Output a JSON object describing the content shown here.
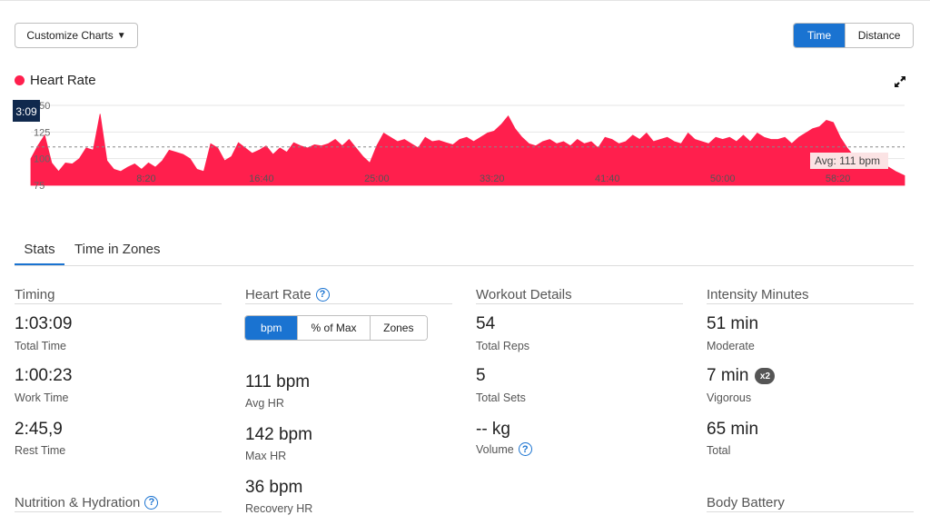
{
  "toolbar": {
    "customize_label": "Customize Charts",
    "customize_icon": "caret-down",
    "axis_toggle": [
      "Time",
      "Distance"
    ],
    "axis_active": "Time"
  },
  "chart": {
    "title": "Heart Rate",
    "series_color": "#ff1f4d",
    "cursor_label": "3:09",
    "avg_label": "Avg: 111 bpm",
    "expand_icon": "expand-arrows-icon"
  },
  "chart_data": {
    "type": "area",
    "title": "Heart Rate",
    "xlabel": "",
    "ylabel": "",
    "ylim": [
      75,
      150
    ],
    "y_ticks": [
      "150",
      "125",
      "100",
      "75"
    ],
    "x_ticks": [
      "8:20",
      "16:40",
      "25:00",
      "33:20",
      "41:40",
      "50:00",
      "58:20"
    ],
    "x_range_seconds": [
      0,
      3789
    ],
    "average": 111,
    "grid": true,
    "series": [
      {
        "color": "#ff1f4d",
        "x_seconds": [
          0,
          30,
          60,
          90,
          120,
          150,
          180,
          210,
          240,
          270,
          300,
          330,
          360,
          390,
          420,
          450,
          480,
          510,
          540,
          570,
          600,
          630,
          660,
          690,
          720,
          750,
          780,
          810,
          840,
          870,
          900,
          930,
          960,
          990,
          1020,
          1050,
          1080,
          1110,
          1140,
          1170,
          1200,
          1230,
          1260,
          1290,
          1320,
          1350,
          1380,
          1410,
          1440,
          1470,
          1500,
          1530,
          1560,
          1590,
          1620,
          1650,
          1680,
          1710,
          1740,
          1770,
          1800,
          1830,
          1860,
          1890,
          1920,
          1950,
          1980,
          2010,
          2040,
          2070,
          2100,
          2130,
          2160,
          2190,
          2220,
          2250,
          2280,
          2310,
          2340,
          2370,
          2400,
          2430,
          2460,
          2490,
          2520,
          2550,
          2580,
          2610,
          2640,
          2670,
          2700,
          2730,
          2760,
          2790,
          2820,
          2850,
          2880,
          2910,
          2940,
          2970,
          3000,
          3030,
          3060,
          3090,
          3120,
          3150,
          3180,
          3210,
          3240,
          3270,
          3300,
          3330,
          3360,
          3390,
          3420,
          3450,
          3480,
          3510,
          3540,
          3570,
          3600,
          3630,
          3660,
          3690,
          3720,
          3750,
          3789
        ],
        "values": [
          100,
          112,
          122,
          96,
          88,
          96,
          95,
          100,
          110,
          108,
          142,
          98,
          90,
          88,
          92,
          95,
          90,
          96,
          92,
          98,
          108,
          106,
          104,
          100,
          90,
          88,
          114,
          110,
          98,
          102,
          115,
          110,
          105,
          108,
          112,
          104,
          110,
          106,
          115,
          112,
          110,
          113,
          112,
          114,
          118,
          112,
          118,
          110,
          102,
          96,
          112,
          124,
          120,
          116,
          118,
          114,
          110,
          120,
          116,
          117,
          115,
          113,
          118,
          120,
          116,
          120,
          124,
          126,
          132,
          140,
          128,
          120,
          114,
          112,
          116,
          118,
          114,
          116,
          112,
          118,
          114,
          116,
          110,
          120,
          118,
          114,
          116,
          122,
          118,
          124,
          116,
          118,
          120,
          116,
          114,
          124,
          118,
          116,
          114,
          120,
          118,
          120,
          116,
          122,
          116,
          124,
          120,
          118,
          118,
          120,
          114,
          120,
          124,
          128,
          130,
          136,
          134,
          120,
          110,
          102,
          96,
          94,
          92,
          90,
          92,
          88,
          84
        ]
      }
    ]
  },
  "tabs": [
    "Stats",
    "Time in Zones"
  ],
  "active_tab": "Stats",
  "timing": {
    "heading": "Timing",
    "stats": [
      {
        "value": "1:03:09",
        "label": "Total Time"
      },
      {
        "value": "1:00:23",
        "label": "Work Time"
      },
      {
        "value": "2:45,9",
        "label": "Rest Time"
      }
    ]
  },
  "heart_rate": {
    "heading": "Heart Rate",
    "help_icon": "question-circle-icon",
    "unit_toggle": [
      "bpm",
      "% of Max",
      "Zones"
    ],
    "unit_active": "bpm",
    "stats": [
      {
        "value": "111 bpm",
        "label": "Avg HR"
      },
      {
        "value": "142 bpm",
        "label": "Max HR"
      },
      {
        "value": "36 bpm",
        "label": "Recovery HR"
      }
    ]
  },
  "workout": {
    "heading": "Workout Details",
    "stats": [
      {
        "value": "54",
        "label": "Total Reps"
      },
      {
        "value": "5",
        "label": "Total Sets"
      },
      {
        "value": "-- kg",
        "label": "Volume"
      }
    ]
  },
  "intensity": {
    "heading": "Intensity Minutes",
    "stats": [
      {
        "value": "51 min",
        "label": "Moderate"
      },
      {
        "value": "7 min",
        "label": "Vigorous",
        "badge": "x2"
      },
      {
        "value": "65 min",
        "label": "Total"
      }
    ]
  },
  "nutrition": {
    "heading": "Nutrition & Hydration"
  },
  "body_battery": {
    "heading": "Body Battery"
  },
  "colors": {
    "accent": "#1a73d1",
    "heart": "#ff1f4d",
    "cursor_box": "#10294d"
  }
}
